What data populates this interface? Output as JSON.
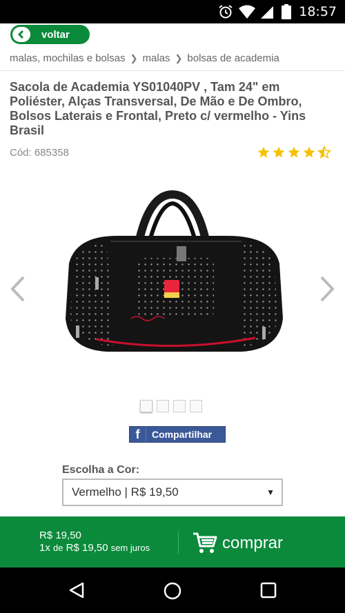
{
  "status_bar": {
    "time": "18:57",
    "icons": [
      "alarm-icon",
      "wifi-icon",
      "signal-icon",
      "battery-icon"
    ]
  },
  "topbar": {
    "back_label": "voltar",
    "back_icon": "chevron-left-icon"
  },
  "breadcrumb": {
    "items": [
      "malas, mochilas e bolsas",
      "malas",
      "bolsas de academia"
    ]
  },
  "product": {
    "title": "Sacola de Academia YS01040PV , Tam 24\" em Poliéster, Alças Transversal, De Mão e De Ombro, Bolsos Laterais e Frontal, Preto c/ vermelho - Yins Brasil",
    "code": "Cód: 685358",
    "rating": 4.5,
    "image_count": 4,
    "active_image": 1
  },
  "share": {
    "label": "Compartilhar",
    "icon": "facebook-icon"
  },
  "color_selector": {
    "label": "Escolha a Cor:",
    "selected": "Vermelho | R$ 19,50"
  },
  "buy_bar": {
    "price": "R$ 19,50",
    "installment_prefix": "1x",
    "installment_de": "de",
    "installment_value": "R$ 19,50",
    "installment_suffix": "sem juros",
    "buy_label": "comprar"
  },
  "nav_bar": {
    "buttons": [
      "back-nav-icon",
      "home-nav-icon",
      "recents-nav-icon"
    ]
  },
  "colors": {
    "green": "#0b8a3c",
    "star": "#f5c200",
    "facebook": "#3b5998"
  }
}
